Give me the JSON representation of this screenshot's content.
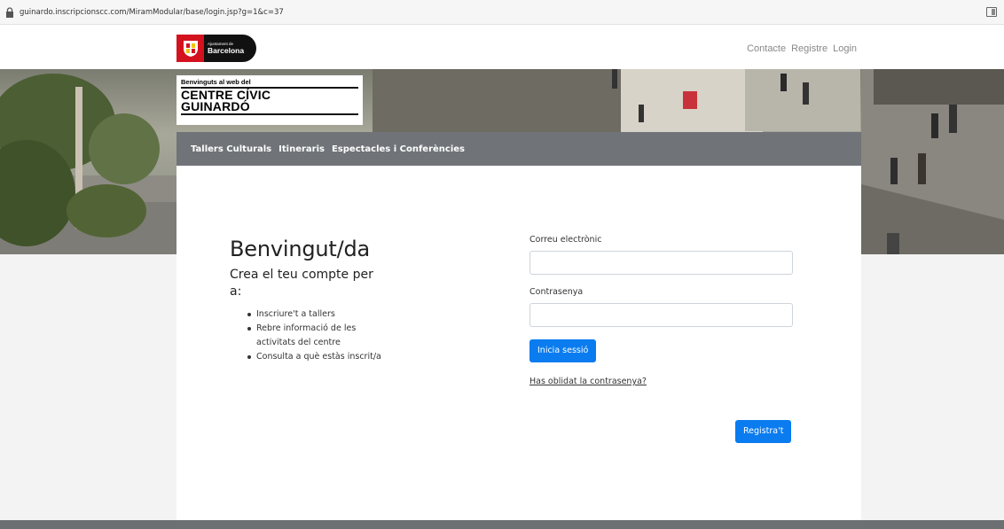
{
  "browser": {
    "url": "guinardo.inscripcionscc.com/MiramModular/base/login.jsp?g=1&c=37"
  },
  "header": {
    "logo": {
      "line1": "Ajuntament de",
      "line2": "Barcelona"
    },
    "nav": [
      "Contacte",
      "Registre",
      "Login"
    ]
  },
  "site_title": {
    "small": "Benvinguts al web del",
    "line1": "CENTRE CÍVIC",
    "line2": "GUINARDÓ"
  },
  "section_nav": [
    "Tallers Culturals",
    "Itineraris",
    "Espectacles i Conferències"
  ],
  "welcome": {
    "title": "Benvingut/da",
    "subtitle": "Crea el teu compte per a:",
    "items": [
      "Inscriure't a tallers",
      "Rebre informació de les activitats del centre",
      "Consulta a què estàs inscrit/a"
    ]
  },
  "login_form": {
    "email_label": "Correu electrònic",
    "password_label": "Contrasenya",
    "submit_label": "Inicia sessió",
    "forgot_link": "Has oblidat la contrasenya?",
    "register_label": "Registra't"
  },
  "colors": {
    "accent": "#0a7cf0",
    "nav_bar": "#707478",
    "brand_red": "#d4121e"
  }
}
